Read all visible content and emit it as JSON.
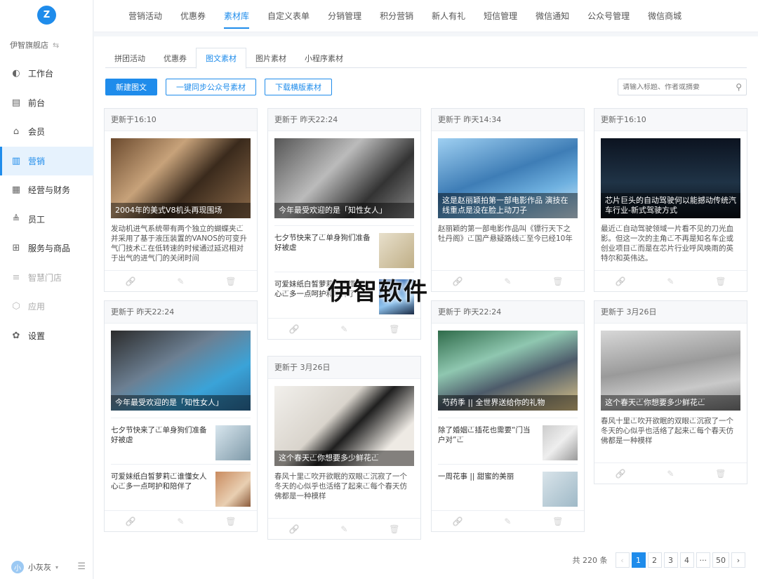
{
  "brand": {
    "logo_text": "Z",
    "store_name": "伊智旗舰店",
    "switch_icon": "⇆"
  },
  "sidebar": {
    "items": [
      {
        "label": "工作台",
        "icon": "dashboard-icon",
        "active": false,
        "dim": false
      },
      {
        "label": "前台",
        "icon": "monitor-icon",
        "active": false,
        "dim": false
      },
      {
        "label": "会员",
        "icon": "member-icon",
        "active": false,
        "dim": false
      },
      {
        "label": "营销",
        "icon": "marketing-icon",
        "active": true,
        "dim": false
      },
      {
        "label": "经营与财务",
        "icon": "finance-icon",
        "active": false,
        "dim": false
      },
      {
        "label": "员工",
        "icon": "staff-icon",
        "active": false,
        "dim": false
      },
      {
        "label": "服务与商品",
        "icon": "goods-icon",
        "active": false,
        "dim": false
      },
      {
        "label": "智慧门店",
        "icon": "smart-store-icon",
        "active": false,
        "dim": true
      },
      {
        "label": "应用",
        "icon": "apps-icon",
        "active": false,
        "dim": true
      },
      {
        "label": "设置",
        "icon": "settings-icon",
        "active": false,
        "dim": false
      }
    ],
    "user": {
      "name": "小灰灰",
      "avatar_text": "小"
    }
  },
  "topnav": {
    "items": [
      "营销活动",
      "优惠券",
      "素材库",
      "自定义表单",
      "分销管理",
      "积分营销",
      "新人有礼",
      "短信管理",
      "微信通知",
      "公众号管理",
      "微信商城"
    ],
    "active_index": 2
  },
  "subtabs": {
    "items": [
      "拼团活动",
      "优惠券",
      "图文素材",
      "图片素材",
      "小程序素材"
    ],
    "active_index": 2
  },
  "actions": {
    "new_label": "新建图文",
    "sync_label": "一键同步公众号素材",
    "download_label": "下载横版素材"
  },
  "search": {
    "placeholder": "请输入标题、作者或摘要"
  },
  "cards": [
    {
      "updated": "更新于16:10",
      "caption": "2004年的美式V8机头再现围场",
      "excerpt": "发动机进气系统带有两个独立的蝴蝶夹𠀀并采用了基于液压装置的VANOS的可变升气门技术𠀀在低转速的时候通过延迟相对于出气的进气门的关闭时间",
      "subs": []
    },
    {
      "updated": "更新于 昨天22:24",
      "caption": "今年最受欢迎的是「知性女人」",
      "excerpt": "",
      "subs": [
        {
          "title": "七夕节快来了𠀀单身狗们准备好被虐"
        },
        {
          "title": "可爱妹纸白皙萝莉𠀀谁懂女人心𠀀多一点呵护和陪伴了"
        }
      ]
    },
    {
      "updated": "更新于 昨天14:34",
      "caption": "这是赵丽颖拍第一部电影作品 演技在线重点是没在脸上动刀子",
      "excerpt": "赵丽颖的第一部电影作品叫《镖行天下之牡丹阁》𠀀国产悬疑路线𠀀至今已经10年",
      "subs": []
    },
    {
      "updated": "更新于16:10",
      "caption": "芯片巨头的自动驾驶何以能撼动传统汽车行业-新式驾驶方式",
      "excerpt": "最近𠀀自动驾驶领域一片看不见的刀光血影。但这一次的主角𠀀不再是知名车企或创业项目𠀀而是在芯片行业呼风唤雨的英特尔和英伟达。",
      "subs": []
    },
    {
      "updated": "更新于 昨天22:24",
      "caption": "今年最受欢迎的是「知性女人」",
      "excerpt": "",
      "subs": [
        {
          "title": "七夕节快来了𠀀单身狗们准备好被虐"
        },
        {
          "title": "可爱妹纸白皙萝莉𠀀谁懂女人心𠀀多一点呵护和陪伴了"
        }
      ]
    },
    {
      "updated": "更新于 3月26日",
      "caption": "这个春天𠀀你想要多少鲜花𠀀",
      "excerpt": "春风十里𠀀吹开欲眠的双眼𠀀沉寂了一个冬天的心似乎也活络了起来𠀀每个春天仿佛都是一种模样",
      "subs": []
    },
    {
      "updated": "更新于 昨天22:24",
      "caption": "芍药季 || 全世界送给你的礼物",
      "excerpt": "",
      "subs": [
        {
          "title": "除了婚姻𠀀插花也需要“门当户对”𠀀"
        },
        {
          "title": "一周花事 || 甜蜜的美丽"
        }
      ]
    },
    {
      "updated": "更新于 3月26日",
      "caption": "这个春天𠀀你想要多少鲜花𠀀",
      "excerpt": "春风十里𠀀吹开欲眠的双眼𠀀沉寂了一个冬天的心似乎也活络了起来𠀀每个春天仿佛都是一种模样",
      "subs": []
    }
  ],
  "pagination": {
    "total_text": "共 220 条",
    "pages": [
      "1",
      "2",
      "3",
      "4",
      "···",
      "50"
    ],
    "current": "1",
    "prev": "‹",
    "next": "›"
  },
  "watermark": "伊智软件",
  "colors": {
    "accent": "#1f8ceb",
    "sidebar_active_bg": "#e6f2fd"
  }
}
